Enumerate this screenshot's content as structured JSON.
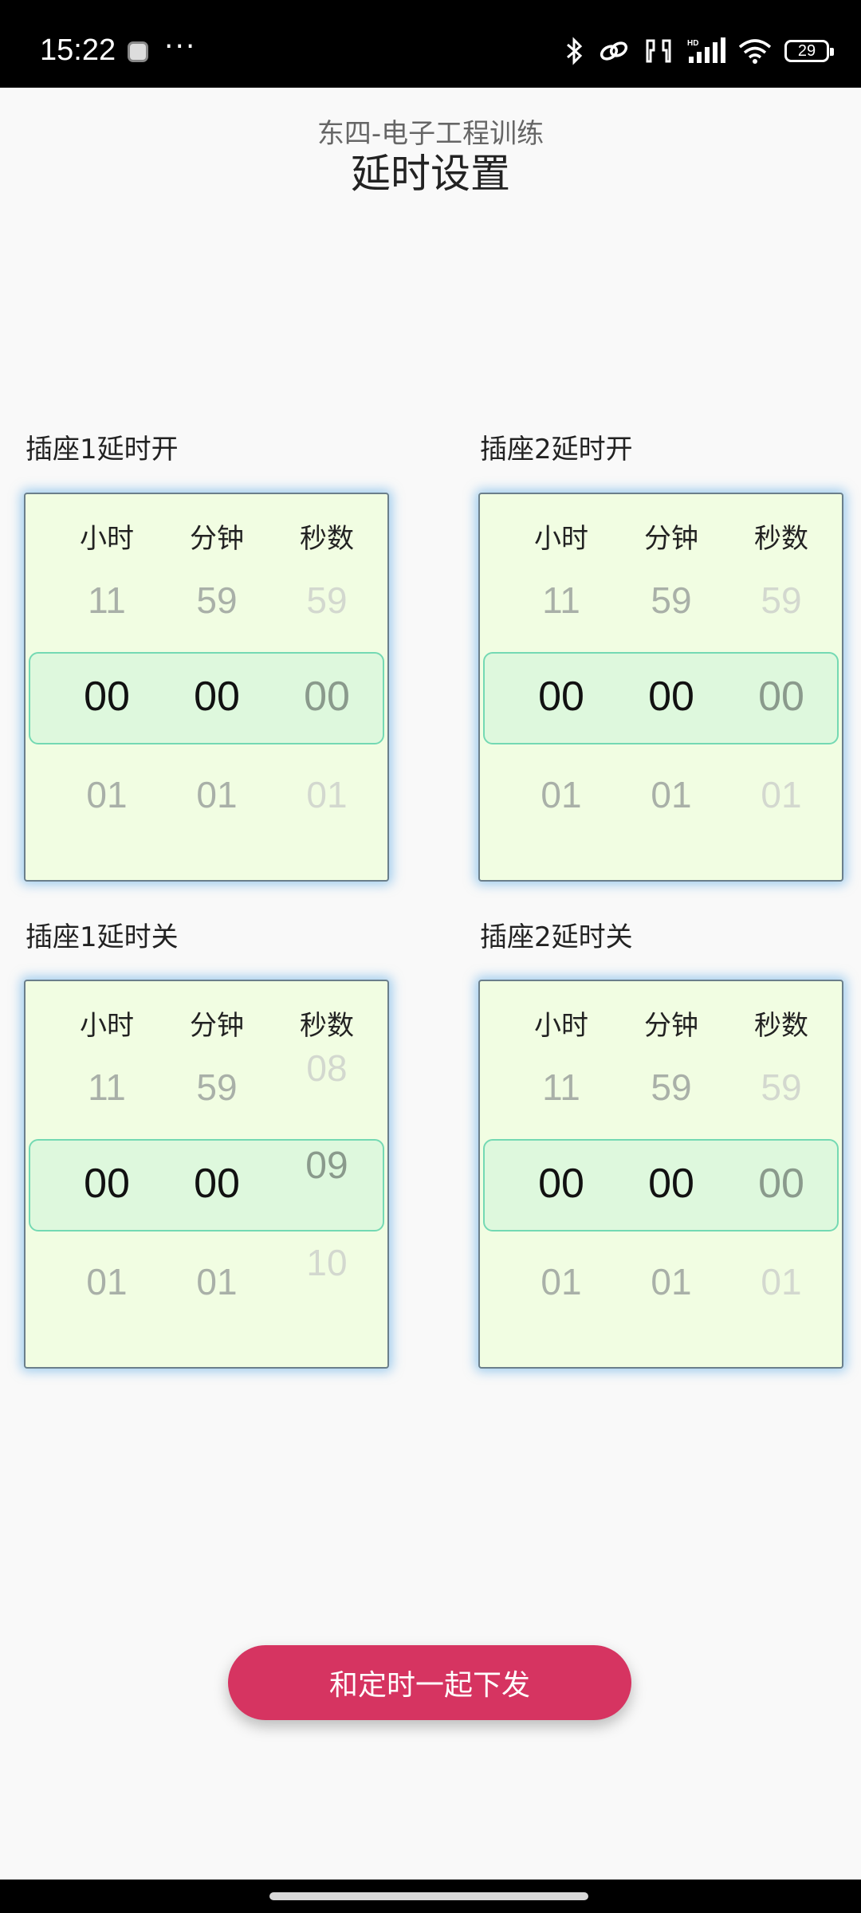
{
  "status_bar": {
    "time": "15:22",
    "more": "···",
    "battery": "29",
    "icons": [
      "bluetooth-icon",
      "link-icon",
      "earbuds-icon",
      "hd-signal-icon",
      "wifi-icon",
      "battery-icon"
    ]
  },
  "header": {
    "subtitle": "东四-电子工程训练",
    "title": "延时设置"
  },
  "columns": [
    "小时",
    "分钟",
    "秒数"
  ],
  "groups": [
    {
      "label": "插座1延时开",
      "hours": {
        "prev": "11",
        "selected": "00",
        "next": "01"
      },
      "minutes": {
        "prev": "59",
        "selected": "00",
        "next": "01"
      },
      "seconds": {
        "prev": "59",
        "selected": "00",
        "next": "01"
      }
    },
    {
      "label": "插座2延时开",
      "hours": {
        "prev": "11",
        "selected": "00",
        "next": "01"
      },
      "minutes": {
        "prev": "59",
        "selected": "00",
        "next": "01"
      },
      "seconds": {
        "prev": "59",
        "selected": "00",
        "next": "01"
      }
    },
    {
      "label": "插座1延时关",
      "hours": {
        "prev": "11",
        "selected": "00",
        "next": "01"
      },
      "minutes": {
        "prev": "59",
        "selected": "00",
        "next": "01"
      },
      "seconds": {
        "prev": "08",
        "selected": "09",
        "next": "10"
      }
    },
    {
      "label": "插座2延时关",
      "hours": {
        "prev": "11",
        "selected": "00",
        "next": "01"
      },
      "minutes": {
        "prev": "59",
        "selected": "00",
        "next": "01"
      },
      "seconds": {
        "prev": "59",
        "selected": "00",
        "next": "01"
      }
    }
  ],
  "submit_button": "和定时一起下发",
  "colors": {
    "picker_bg": "#f1fde2",
    "selection_bg": "#def8dd",
    "selection_border": "#74d9b3",
    "button": "#d63461"
  }
}
